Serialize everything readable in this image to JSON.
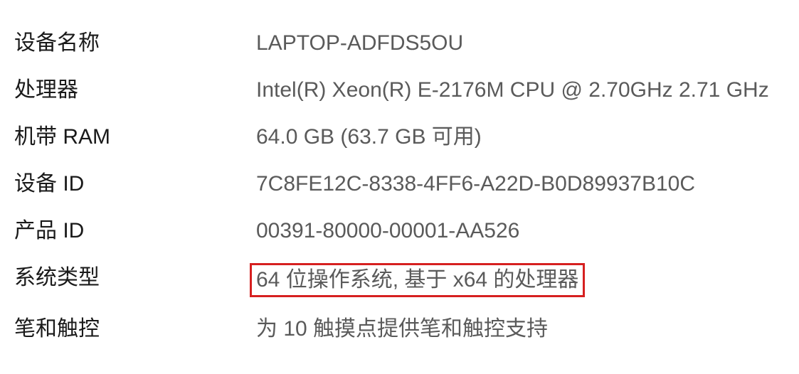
{
  "specs": {
    "device_name": {
      "label": "设备名称",
      "value": "LAPTOP-ADFDS5OU"
    },
    "processor": {
      "label": "处理器",
      "value": "Intel(R) Xeon(R) E-2176M  CPU @ 2.70GHz   2.71 GHz"
    },
    "installed_ram": {
      "label": "机带 RAM",
      "value": "64.0 GB (63.7 GB 可用)"
    },
    "device_id": {
      "label": "设备 ID",
      "value": "7C8FE12C-8338-4FF6-A22D-B0D89937B10C"
    },
    "product_id": {
      "label": "产品 ID",
      "value": "00391-80000-00001-AA526"
    },
    "system_type": {
      "label": "系统类型",
      "value": "64 位操作系统, 基于 x64 的处理器"
    },
    "pen_touch": {
      "label": "笔和触控",
      "value": "为 10 触摸点提供笔和触控支持"
    }
  },
  "highlight_color": "#d62020"
}
